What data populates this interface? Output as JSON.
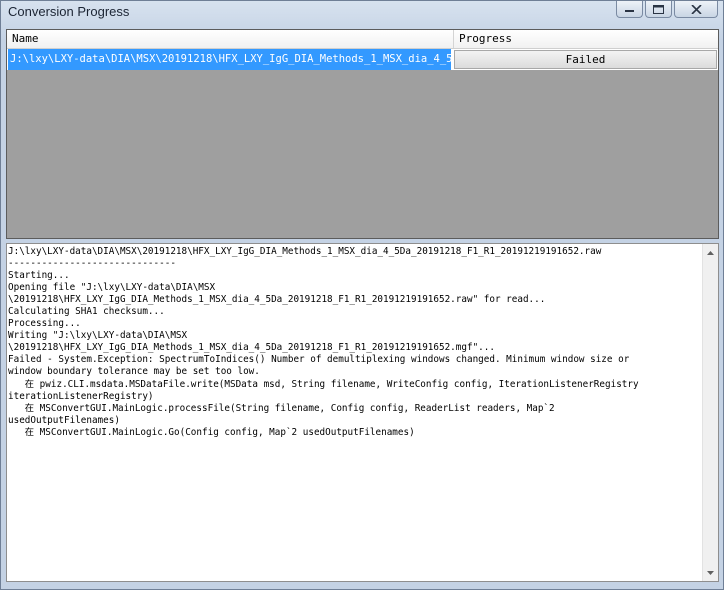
{
  "window": {
    "title": "Conversion Progress",
    "controls": {
      "minimize": "minimize-icon",
      "maximize": "maximize-icon",
      "close": "close-icon"
    }
  },
  "grid": {
    "columns": [
      "Name",
      "Progress"
    ],
    "rows": [
      {
        "name": "J:\\lxy\\LXY-data\\DIA\\MSX\\20191218\\HFX_LXY_IgG_DIA_Methods_1_MSX_dia_4_5...",
        "progress": "Failed"
      }
    ]
  },
  "log": {
    "lines": [
      "J:\\lxy\\LXY-data\\DIA\\MSX\\20191218\\HFX_LXY_IgG_DIA_Methods_1_MSX_dia_4_5Da_20191218_F1_R1_20191219191652.raw",
      "------------------------------",
      "Starting...",
      "Opening file \"J:\\lxy\\LXY-data\\DIA\\MSX",
      "\\20191218\\HFX_LXY_IgG_DIA_Methods_1_MSX_dia_4_5Da_20191218_F1_R1_20191219191652.raw\" for read...",
      "Calculating SHA1 checksum...",
      "Processing...",
      "Writing \"J:\\lxy\\LXY-data\\DIA\\MSX",
      "\\20191218\\HFX_LXY_IgG_DIA_Methods_1_MSX_dia_4_5Da_20191218_F1_R1_20191219191652.mgf\"...",
      "Failed - System.Exception: SpectrumToIndices() Number of demultiplexing windows changed. Minimum window size or",
      "window boundary tolerance may be set too low.",
      "   在 pwiz.CLI.msdata.MSDataFile.write(MSData msd, String filename, WriteConfig config, IterationListenerRegistry",
      "iterationListenerRegistry)",
      "   在 MSConvertGUI.MainLogic.processFile(String filename, Config config, ReaderList readers, Map`2",
      "usedOutputFilenames)",
      "   在 MSConvertGUI.MainLogic.Go(Config config, Map`2 usedOutputFilenames)"
    ]
  },
  "colors": {
    "selection": "#3399ff",
    "grid_background": "#9f9f9f",
    "title_bar": "#c4d2e4"
  }
}
